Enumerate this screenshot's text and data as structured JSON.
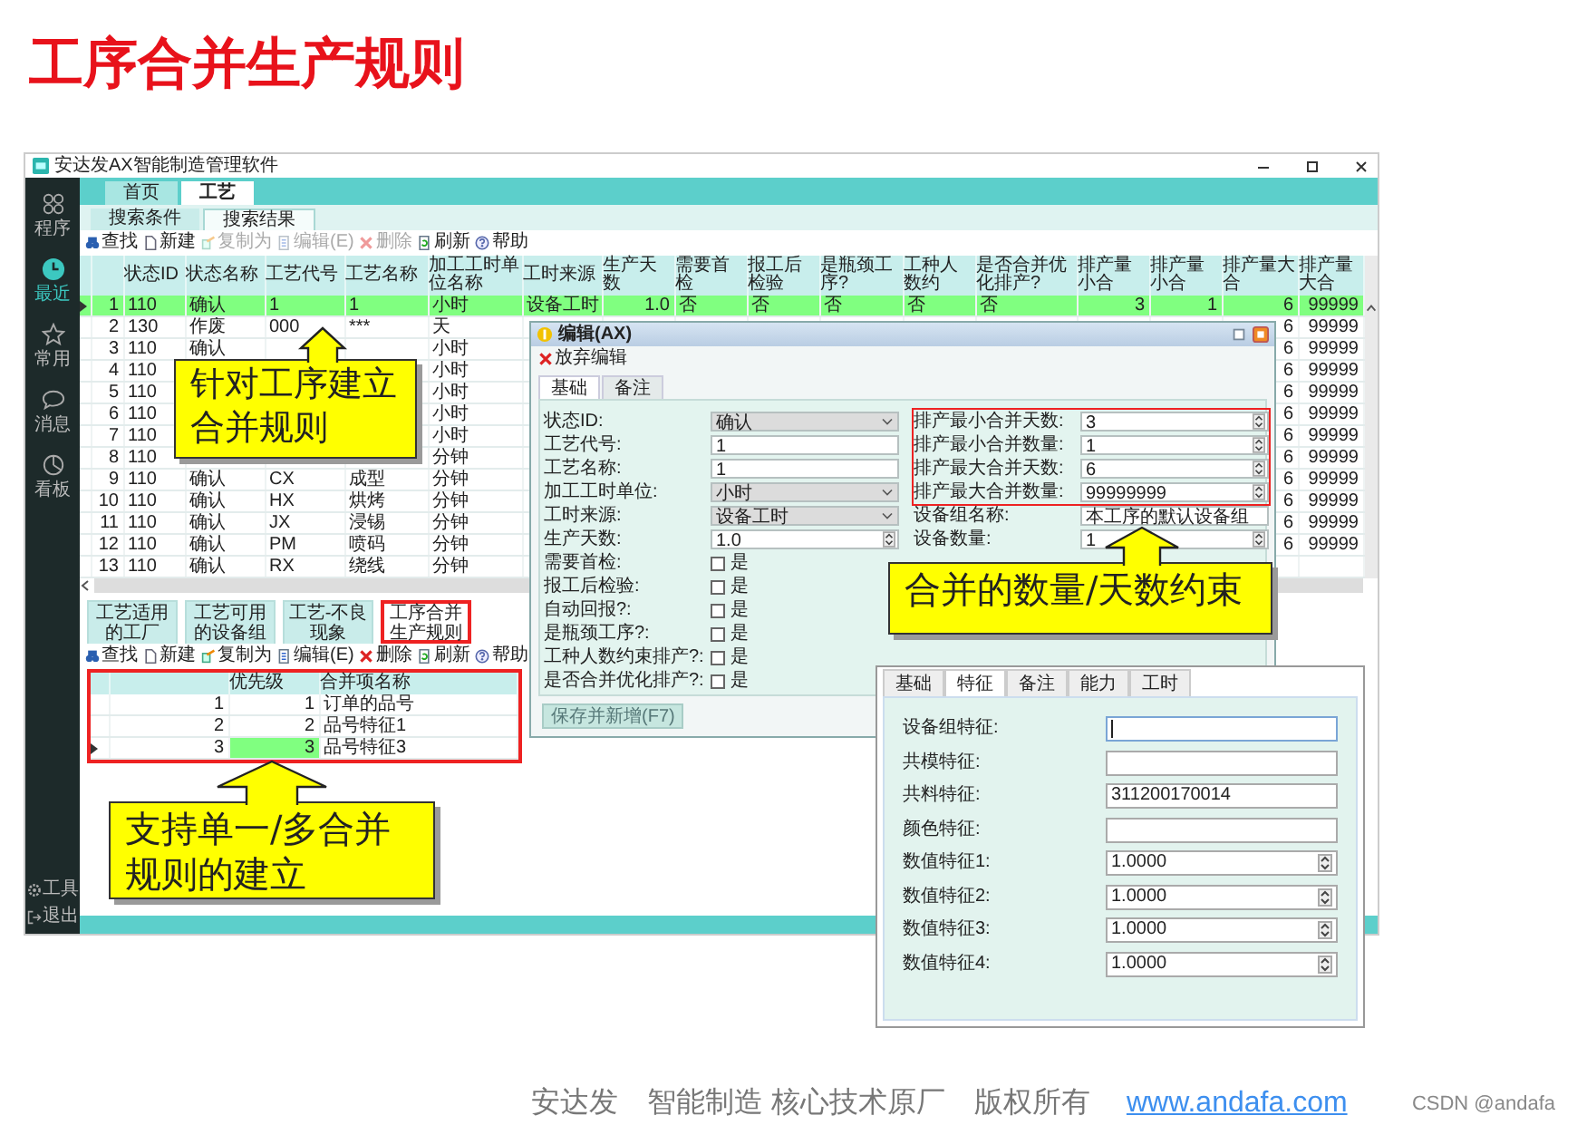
{
  "slide_title": "工序合并生产规则",
  "window": {
    "title": "安达发AX智能制造管理软件"
  },
  "sidebar": {
    "items": [
      {
        "label": "程序",
        "kind": "apps",
        "selected": false
      },
      {
        "label": "最近",
        "kind": "clock",
        "selected": true
      },
      {
        "label": "常用",
        "kind": "star",
        "selected": false
      },
      {
        "label": "消息",
        "kind": "chat",
        "selected": false
      },
      {
        "label": "看板",
        "kind": "chart",
        "selected": false
      }
    ],
    "bottom_items": [
      {
        "label": "工具",
        "kind": "gear"
      },
      {
        "label": "退出",
        "kind": "exit"
      }
    ]
  },
  "main_tabs": [
    {
      "label": "首页",
      "selected": false
    },
    {
      "label": "工艺",
      "selected": true
    }
  ],
  "sub_tabs": [
    {
      "label": "搜索条件",
      "selected": false
    },
    {
      "label": "搜索结果",
      "selected": true
    }
  ],
  "toolbar": [
    {
      "label": "查找",
      "kind": "find",
      "disabled": false
    },
    {
      "label": "新建",
      "kind": "new",
      "disabled": false
    },
    {
      "label": "复制为",
      "kind": "copy",
      "disabled": true
    },
    {
      "label": "编辑(E)",
      "kind": "edit",
      "disabled": true
    },
    {
      "label": "删除",
      "kind": "delete",
      "disabled": true
    },
    {
      "label": "刷新",
      "kind": "refresh",
      "disabled": false
    },
    {
      "label": "帮助",
      "kind": "help",
      "disabled": false
    }
  ],
  "table": {
    "columns": [
      "状态ID",
      "状态名称",
      "工艺代号",
      "工艺名称",
      "加工工时单位名称",
      "工时来源",
      "生产天数",
      "需要首检",
      "报工后检验",
      "是瓶颈工序?",
      "工种人数约",
      "是否合并优化排产?",
      "排产量小合",
      "排产量小合",
      "排产量大合",
      "排产量大合"
    ],
    "rows": [
      {
        "no": "1",
        "selected": true,
        "cells": [
          "110",
          "确认",
          "1",
          "1",
          "小时",
          "设备工时",
          "1.0",
          "否",
          "否",
          "否",
          "否",
          "否",
          "3",
          "1",
          "6",
          "99999"
        ]
      },
      {
        "no": "2",
        "selected": false,
        "cells": [
          "130",
          "作废",
          "000",
          "***",
          "天"
        ],
        "end_cells": [
          "6",
          "99999"
        ]
      },
      {
        "no": "3",
        "selected": false,
        "cells": [
          "110",
          "确认",
          null,
          null,
          "小时"
        ],
        "end_cells": [
          "6",
          "99999"
        ]
      },
      {
        "no": "4",
        "selected": false,
        "cells": [
          "110",
          null,
          null,
          null,
          "小时"
        ],
        "end_cells": [
          "6",
          "99999"
        ]
      },
      {
        "no": "5",
        "selected": false,
        "cells": [
          "110",
          null,
          null,
          null,
          "小时"
        ],
        "end_cells": [
          "6",
          "99999"
        ]
      },
      {
        "no": "6",
        "selected": false,
        "cells": [
          "110",
          null,
          null,
          null,
          "小时"
        ],
        "end_cells": [
          "6",
          "99999"
        ]
      },
      {
        "no": "7",
        "selected": false,
        "cells": [
          "110",
          null,
          null,
          null,
          "小时"
        ],
        "end_cells": [
          "6",
          "99999"
        ]
      },
      {
        "no": "8",
        "selected": false,
        "cells": [
          "110",
          null,
          null,
          null,
          "分钟"
        ],
        "end_cells": [
          "6",
          "99999"
        ]
      },
      {
        "no": "9",
        "selected": false,
        "cells": [
          "110",
          "确认",
          "CX",
          "成型",
          "分钟"
        ],
        "end_cells": [
          "6",
          "99999"
        ]
      },
      {
        "no": "10",
        "selected": false,
        "cells": [
          "110",
          "确认",
          "HX",
          "烘烤",
          "分钟"
        ],
        "end_cells": [
          "6",
          "99999"
        ]
      },
      {
        "no": "11",
        "selected": false,
        "cells": [
          "110",
          "确认",
          "JX",
          "浸锡",
          "分钟"
        ],
        "end_cells": [
          "6",
          "99999"
        ]
      },
      {
        "no": "12",
        "selected": false,
        "cells": [
          "110",
          "确认",
          "PM",
          "喷码",
          "分钟"
        ],
        "end_cells": [
          "6",
          "99999"
        ]
      },
      {
        "no": "13",
        "selected": false,
        "cells": [
          "110",
          "确认",
          "RX",
          "绕线",
          "分钟"
        ]
      }
    ]
  },
  "bottom_tabs": [
    {
      "label": "工艺适用的工厂",
      "selected": false,
      "highlighted": false
    },
    {
      "label": "工艺可用的设备组",
      "selected": false,
      "highlighted": false
    },
    {
      "label": "工艺-不良现象",
      "selected": false,
      "highlighted": false
    },
    {
      "label": "工序合并生产规则",
      "selected": true,
      "highlighted": true
    }
  ],
  "bottom_toolbar": [
    {
      "label": "查找",
      "kind": "find",
      "disabled": false
    },
    {
      "label": "新建",
      "kind": "new",
      "disabled": false
    },
    {
      "label": "复制为",
      "kind": "copy",
      "disabled": false
    },
    {
      "label": "编辑(E)",
      "kind": "edit",
      "disabled": false
    },
    {
      "label": "删除",
      "kind": "delete",
      "disabled": false
    },
    {
      "label": "刷新",
      "kind": "refresh",
      "disabled": false
    },
    {
      "label": "帮助",
      "kind": "help",
      "disabled": false
    }
  ],
  "rules_table": {
    "highlighted": true,
    "columns": [
      "优先级",
      "合并项名称"
    ],
    "rows": [
      {
        "no": "1",
        "priority": "1",
        "name": "订单的品号",
        "selected": false
      },
      {
        "no": "2",
        "priority": "2",
        "name": "品号特征1",
        "selected": false
      },
      {
        "no": "3",
        "priority": "3",
        "name": "品号特征3",
        "selected": true
      }
    ]
  },
  "edit_dialog": {
    "title": "编辑(AX)",
    "toolbar": [
      "放弃编辑"
    ],
    "tabs": [
      {
        "label": "基础",
        "selected": true
      },
      {
        "label": "备注",
        "selected": false
      }
    ],
    "left_fields": [
      {
        "label": "状态ID:",
        "kind": "select",
        "value": "确认"
      },
      {
        "label": "工艺代号:",
        "kind": "text",
        "value": "1"
      },
      {
        "label": "工艺名称:",
        "kind": "text",
        "value": "1"
      },
      {
        "label": "加工工时单位:",
        "kind": "select",
        "value": "小时"
      },
      {
        "label": "工时来源:",
        "kind": "select",
        "value": "设备工时"
      },
      {
        "label": "生产天数:",
        "kind": "spin",
        "value": "1.0"
      },
      {
        "label": "需要首检:",
        "kind": "checkbox",
        "checked": false,
        "text": "是"
      },
      {
        "label": "报工后检验:",
        "kind": "checkbox",
        "checked": false,
        "text": "是"
      },
      {
        "label": "自动回报?:",
        "kind": "checkbox",
        "checked": false,
        "text": "是"
      },
      {
        "label": "是瓶颈工序?:",
        "kind": "checkbox",
        "checked": false,
        "text": "是"
      },
      {
        "label": "工种人数约束排产?:",
        "kind": "checkbox",
        "checked": false,
        "text": "是"
      },
      {
        "label": "是否合并优化排产?:",
        "kind": "checkbox",
        "checked": false,
        "text": "是"
      }
    ],
    "right_frame": {
      "highlighted": true,
      "fields": [
        {
          "label": "排产最小合并天数:",
          "kind": "spin",
          "value": "3"
        },
        {
          "label": "排产最小合并数量:",
          "kind": "spin",
          "value": "1"
        },
        {
          "label": "排产最大合并天数:",
          "kind": "spin",
          "value": "6"
        },
        {
          "label": "排产最大合并数量:",
          "kind": "spin",
          "value": "99999999"
        }
      ]
    },
    "right_fields": [
      {
        "label": "设备组名称:",
        "kind": "text",
        "value": "本工序的默认设备组"
      },
      {
        "label": "设备数量:",
        "kind": "spin",
        "value": "1"
      }
    ],
    "button": "保存并新增(F7)"
  },
  "feature_dialog": {
    "tabs": [
      {
        "label": "基础",
        "selected": false
      },
      {
        "label": "特征",
        "selected": true
      },
      {
        "label": "备注",
        "selected": false
      },
      {
        "label": "能力",
        "selected": false
      },
      {
        "label": "工时",
        "selected": false
      }
    ],
    "fields": [
      {
        "label": "设备组特征:",
        "kind": "text",
        "focused": true
      },
      {
        "label": "共模特征:",
        "kind": "text",
        "focused": false
      },
      {
        "label": "共料特征:",
        "kind": "text",
        "value": "311200170014",
        "focused": false
      },
      {
        "label": "颜色特征:",
        "kind": "text",
        "focused": false
      },
      {
        "label": "数值特征1:",
        "kind": "spin",
        "value": "1.0000",
        "focused": false
      },
      {
        "label": "数值特征2:",
        "kind": "spin",
        "value": "1.0000",
        "focused": false
      },
      {
        "label": "数值特征3:",
        "kind": "spin",
        "value": "1.0000",
        "focused": false
      },
      {
        "label": "数值特征4:",
        "kind": "spin",
        "value": "1.0000",
        "focused": false
      }
    ]
  },
  "callouts": [
    {
      "text": "针对工序建立合并规则"
    },
    {
      "text": "合并的数量/天数约束"
    },
    {
      "text": "支持单一/多合并规则的建立"
    }
  ],
  "footer": {
    "company": "安达发",
    "slogan": "智能制造 核心技术原厂",
    "rights": "版权所有",
    "link": "www.andafa.com",
    "credit": "CSDN @andafa"
  }
}
